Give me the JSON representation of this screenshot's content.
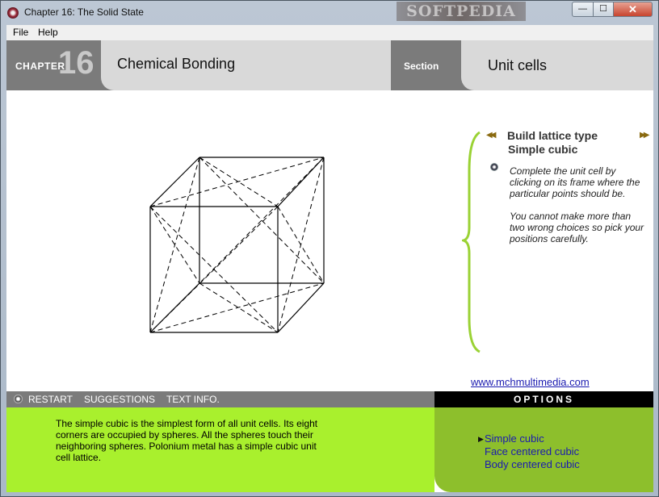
{
  "window": {
    "title": "Chapter 16: The Solid State",
    "watermark": "SOFTPEDIA"
  },
  "title_buttons": {
    "minimize": "—",
    "maximize": "☐",
    "close": "✕"
  },
  "menu": [
    "File",
    "Help"
  ],
  "header": {
    "chapter_label": "CHAPTER",
    "chapter_number": "16",
    "title": "Chemical Bonding",
    "section_label": "Section",
    "section_value": "Unit cells"
  },
  "panel": {
    "nav_prev": "◀◀",
    "nav_next": "▶▶",
    "build_label": "Build lattice type",
    "build_value": "Simple cubic",
    "instructions": [
      "Complete the unit cell by clicking on its frame where the particular points should be.",
      "You cannot make more than two wrong choices so pick your positions carefully."
    ]
  },
  "link": "www.mchmultimedia.com",
  "controls": {
    "restart": "RESTART",
    "suggestions": "SUGGESTIONS",
    "text_info": "TEXT INFO."
  },
  "description": "The simple cubic is the simplest form of all unit cells. Its eight corners are occupied by spheres.  All the spheres touch their neighboring spheres. Polonium metal has a simple cubic unit cell lattice.",
  "options": {
    "header": "OPTIONS",
    "items": [
      "Simple cubic",
      "Face centered cubic",
      "Body centered cubic"
    ],
    "selected_index": 0
  },
  "colors": {
    "header_gray": "#7b7b7b",
    "lime": "#a9f02d",
    "options_green": "#8dbf2c",
    "link_blue": "#1a1ab0"
  }
}
